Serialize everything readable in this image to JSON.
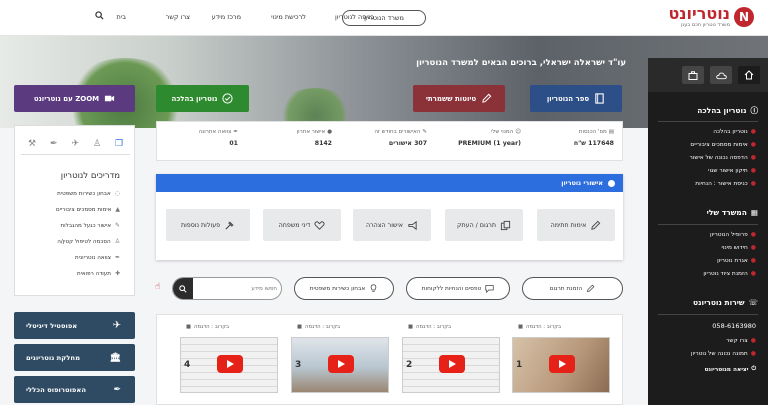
{
  "brand": {
    "logo_letter": "N",
    "name": "נוטריונט",
    "tagline": "משרד נוטריון חכם בענן",
    "accent": "#c0262d"
  },
  "topnav": {
    "office_button": "משרד הנוטריון",
    "items": [
      "כניסה לנוטריון",
      "לרכישת מינוי",
      "מרכז מידע",
      "צרו קשר",
      "בית"
    ]
  },
  "hero": {
    "title": "עו\"ד ישראלה ישראלי, ברוכים הבאים למשרד הנוטריון"
  },
  "actions": [
    {
      "label": "ספר הנוטריון",
      "color": "#2d4f87",
      "icon": "book-icon"
    },
    {
      "label": "טיוטות ששמרתי",
      "color": "#8b3238",
      "icon": "pencil-icon"
    },
    {
      "label": "נוטריון בהלכה",
      "color": "#2e8a2e",
      "icon": "check-circle-icon"
    },
    {
      "label": "ZOOM עם נוטריונט",
      "color": "#5b3a80",
      "icon": "video-icon"
    }
  ],
  "stats": [
    {
      "label": "מס' הכנסות",
      "value": "117648 ש\"ח"
    },
    {
      "label": "המנוי שלי",
      "value": "PREMIUM (1 year)"
    },
    {
      "label": "האישורים בחודש זה",
      "value": "307 אישורים"
    },
    {
      "label": "אישור אחרון",
      "value": "8142"
    },
    {
      "label": "צוואה אחרונה",
      "value": "01"
    }
  ],
  "approvals": {
    "header": "אישורי נוטריון",
    "buttons": [
      "אימות חתימה",
      "תרגום / העתק",
      "אישור הצהרה",
      "דיני משפחה",
      "פעולות נוספות"
    ]
  },
  "quick_links": [
    "הזמנת תרגום",
    "טפסים והנחיות ללקוחות",
    "אבחון כשירות משפטית"
  ],
  "search": {
    "placeholder": "חפשו מידע"
  },
  "videos": [
    {
      "label": "בקרוב : הדגמה",
      "number": "1"
    },
    {
      "label": "בקרוב : הדגמה",
      "number": "2"
    },
    {
      "label": "בקרוב : הדגמה",
      "number": "3"
    },
    {
      "label": "בקרוב : הדגמה",
      "number": "4"
    }
  ],
  "guides": {
    "title": "מדריכים לנוטריון",
    "items": [
      "אבחון כשירות משפטית",
      "אימות מסמכים ציבוריים",
      "אישור כגעל מהגבלות",
      "הסכמה לטיפול קטין/ה",
      "צוואה נוטריונית",
      "תעודה רפואית"
    ]
  },
  "left_buttons": [
    "אפוסטיל דיגיטלי",
    "מחלקת נוטריונים",
    "האפוטרופוס הכללי"
  ],
  "sidebar": {
    "section1": {
      "title": "נוטריון בהלכה",
      "items": [
        "נוטריון בהלכה",
        "אימות מסמכים ציבוריים",
        "הדפסה נכונה של אישור",
        "תיקון אישור שגוי",
        "כניסת אישור : הנחיות"
      ]
    },
    "section2": {
      "title": "המשרד שלי",
      "items": [
        "פרופיל הנוטריון",
        "חידוש מינוי",
        "אגרת נוטריון",
        "הזמנת ציוד נוטריון"
      ]
    },
    "section3": {
      "title": "שירות נוטריונט",
      "items": [
        "058-6163980",
        "צרו קשר",
        "תמונה נכונה של נוטריון"
      ]
    },
    "logout": "יציאה מנוטריונט"
  }
}
